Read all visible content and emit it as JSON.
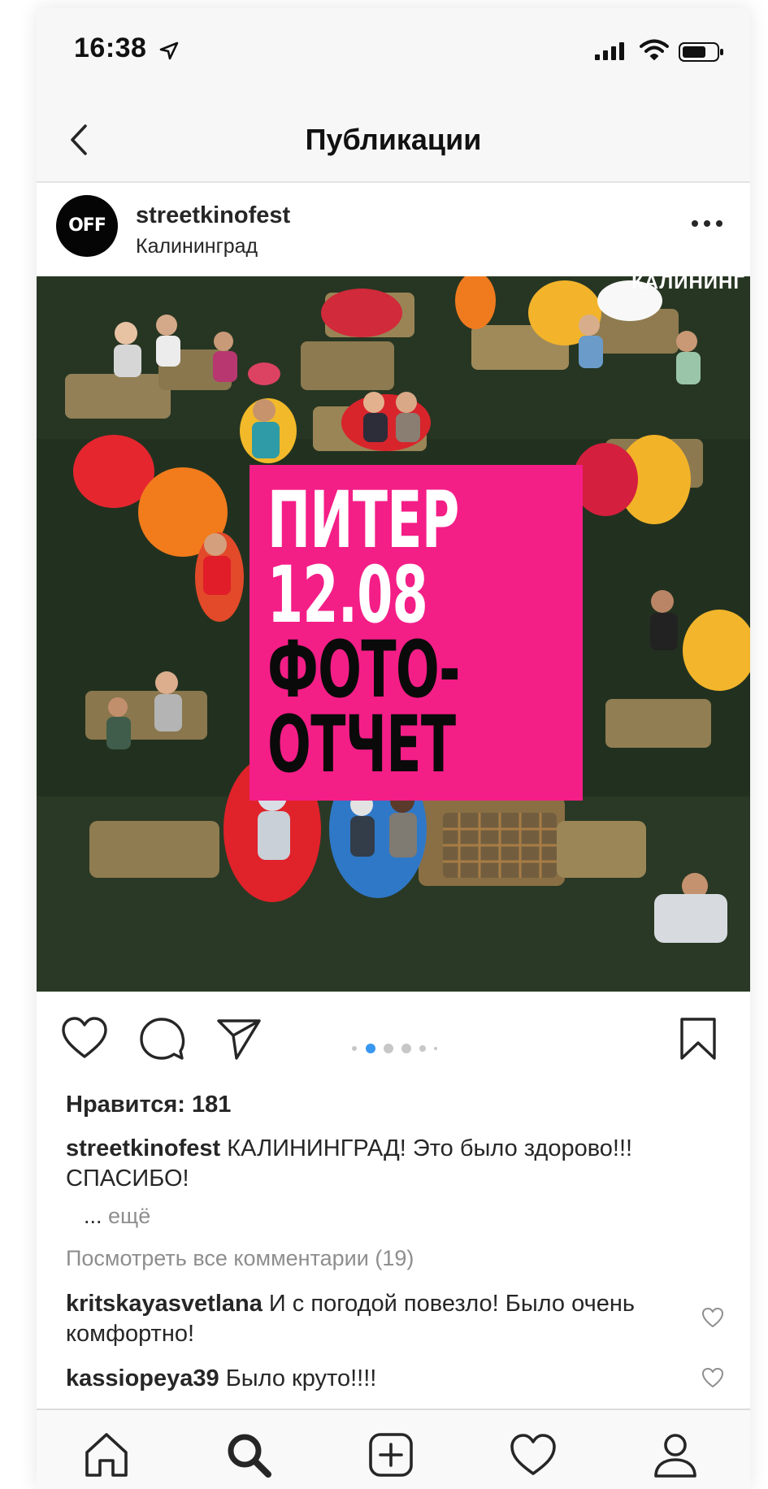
{
  "status_bar": {
    "time": "16:38"
  },
  "nav": {
    "title": "Публикации"
  },
  "post": {
    "username": "streetkinofest",
    "location": "Калининград",
    "avatar_text": "OFF",
    "image": {
      "corner_text": "КАЛИНИНГ",
      "lines": [
        "ПИТЕР",
        "12.08",
        "ФОТО-",
        "ОТЧЕТ"
      ],
      "block_color": "#f41e87"
    },
    "carousel": {
      "count": 6,
      "active_index": 1
    },
    "likes_text": "Нравится: 181",
    "caption": {
      "username": "streetkinofest",
      "text": "КАЛИНИНГРАД! Это было здорово!!! СПАСИБО!"
    },
    "more_dots": "...",
    "more_label": "ещё",
    "view_comments": "Посмотреть все комментарии (19)",
    "comments": [
      {
        "username": "kritskayasvetlana",
        "text": "И с погодой повезло! Было очень комфортно!"
      },
      {
        "username": "kassiopeya39",
        "text": "Было круто!!!!"
      }
    ]
  },
  "colors": {
    "accent_blue": "#3897f0",
    "text": "#262626",
    "secondary": "#8e8e8e"
  },
  "icons": {
    "back": "chevron-left-icon",
    "more": "more-horizontal-icon",
    "like": "heart-icon",
    "comment": "comment-icon",
    "share": "paper-plane-icon",
    "save": "bookmark-icon",
    "tabs": [
      "home-icon",
      "search-icon",
      "plus-square-icon",
      "heart-icon",
      "user-icon"
    ]
  }
}
